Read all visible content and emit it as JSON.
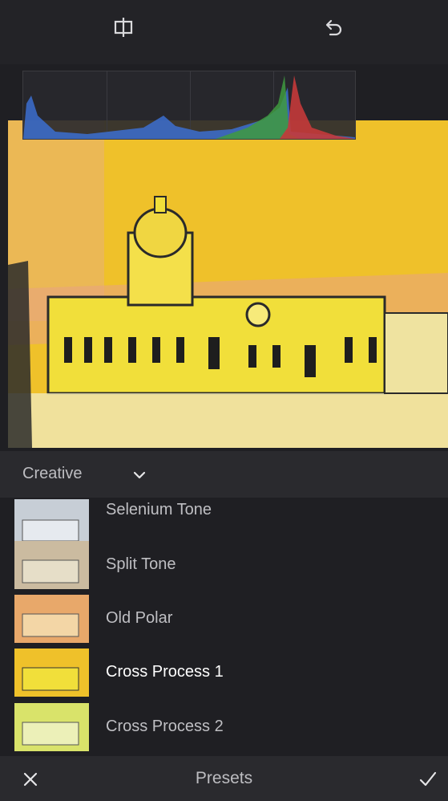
{
  "toolbar": {
    "compare_icon": "split-view-icon",
    "undo_icon": "undo-icon"
  },
  "histogram": {
    "channels": [
      "blue",
      "green",
      "red"
    ]
  },
  "photo": {
    "tint": "#efc12a"
  },
  "category": {
    "label": "Creative",
    "icon": "chevron-down-icon"
  },
  "presets": [
    {
      "label": "Selenium Tone",
      "thumb_color": "#c7ced6"
    },
    {
      "label": "Split Tone",
      "thumb_color": "#cbbba0"
    },
    {
      "label": "Old Polar",
      "thumb_color": "#e8a86a"
    },
    {
      "label": "Cross Process 1",
      "thumb_color": "#efc12a",
      "selected": true
    },
    {
      "label": "Cross Process 2",
      "thumb_color": "#d9e36a"
    }
  ],
  "footer": {
    "title": "Presets",
    "cancel_icon": "close-icon",
    "confirm_icon": "checkmark-icon"
  }
}
